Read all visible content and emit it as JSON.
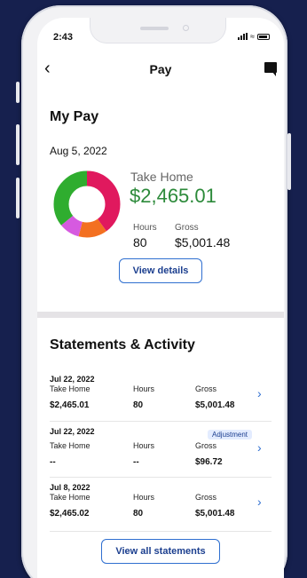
{
  "status": {
    "time": "2:43"
  },
  "nav": {
    "title": "Pay"
  },
  "my_pay": {
    "title": "My Pay",
    "date": "Aug 5, 2022",
    "take_home_label": "Take Home",
    "take_home_value": "$2,465.01",
    "hours_label": "Hours",
    "hours_value": "80",
    "gross_label": "Gross",
    "gross_value": "$5,001.48",
    "view_details": "View details",
    "donut_segments": [
      {
        "color": "#e0195e",
        "fraction": 0.4
      },
      {
        "color": "#f37021",
        "fraction": 0.14
      },
      {
        "color": "#d65ae0",
        "fraction": 0.1
      },
      {
        "color": "#2fad2f",
        "fraction": 0.36
      }
    ]
  },
  "statements": {
    "title": "Statements & Activity",
    "rows": [
      {
        "date": "Jul 22, 2022",
        "take_home_label": "Take Home",
        "take_home": "$2,465.01",
        "hours_label": "Hours",
        "hours": "80",
        "gross_label": "Gross",
        "gross": "$5,001.48",
        "badge": ""
      },
      {
        "date": "Jul 22, 2022",
        "take_home_label": "Take Home",
        "take_home": "--",
        "hours_label": "Hours",
        "hours": "--",
        "gross_label": "Gross",
        "gross": "$96.72",
        "badge": "Adjustment"
      },
      {
        "date": "Jul 8, 2022",
        "take_home_label": "Take Home",
        "take_home": "$2,465.02",
        "hours_label": "Hours",
        "hours": "80",
        "gross_label": "Gross",
        "gross": "$5,001.48",
        "badge": ""
      }
    ],
    "view_all": "View all statements"
  },
  "colors": {
    "accent": "#2f6fd0",
    "take_home": "#2c8a3a",
    "background": "#16204e"
  }
}
